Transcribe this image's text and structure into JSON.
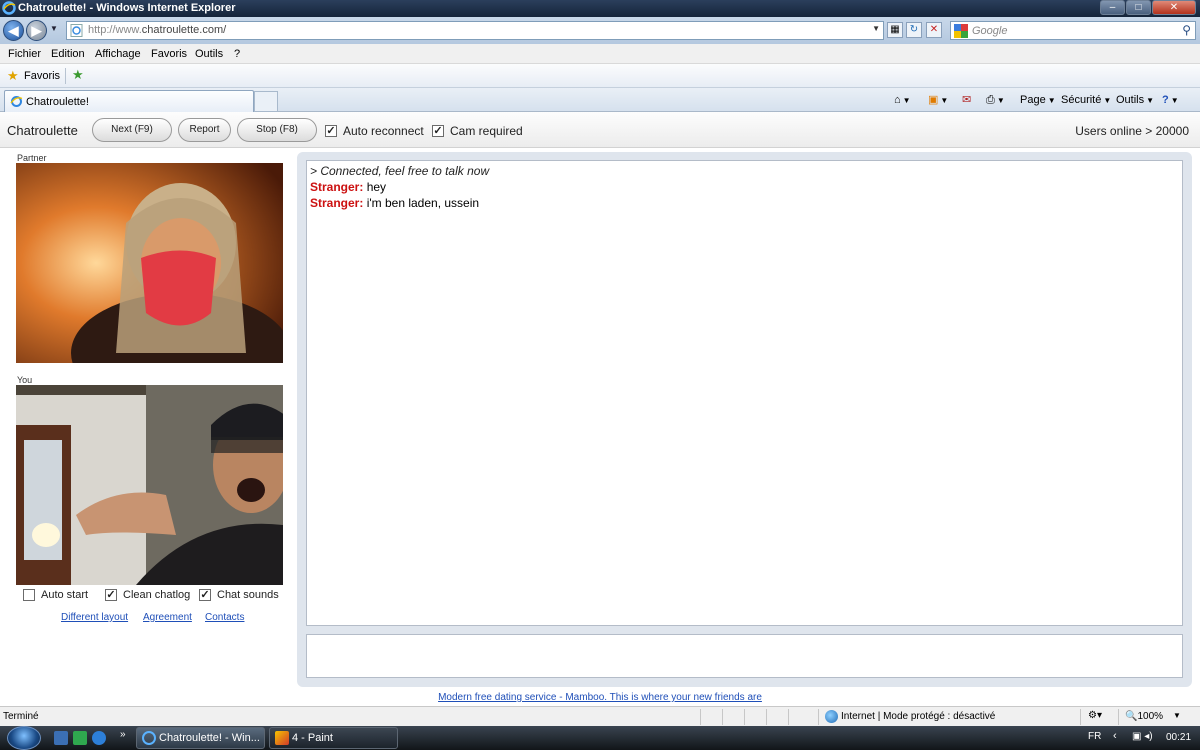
{
  "window": {
    "title": "Chatroulette! - Windows Internet Explorer",
    "controls": {
      "minimize": "–",
      "maximize": "□",
      "close": "✕"
    }
  },
  "address": {
    "url_prefix": "http://www.",
    "url_domain": "chatroulette.com/",
    "search_placeholder": "Google"
  },
  "menu": [
    "Fichier",
    "Edition",
    "Affichage",
    "Favoris",
    "Outils",
    "?"
  ],
  "favorites": {
    "label": "Favoris"
  },
  "tab": {
    "label": "Chatroulette!"
  },
  "commands": {
    "page": "Page",
    "security": "Sécurité",
    "tools": "Outils"
  },
  "app": {
    "name": "Chatroulette",
    "buttons": {
      "next": "Next (F9)",
      "report": "Report",
      "stop": "Stop (F8)"
    },
    "toggles": [
      {
        "label": "Auto reconnect",
        "checked": true
      },
      {
        "label": "Cam required",
        "checked": true
      }
    ],
    "users_online": "Users online > 20000",
    "partner_label": "Partner",
    "you_label": "You",
    "options": [
      {
        "label": "Auto start",
        "checked": false
      },
      {
        "label": "Clean chatlog",
        "checked": true
      },
      {
        "label": "Chat sounds",
        "checked": true
      }
    ],
    "links": [
      "Different layout",
      "Agreement",
      "Contacts"
    ],
    "chat": {
      "system": "> Connected, feel free to talk now",
      "messages": [
        {
          "sender": "Stranger:",
          "text": "hey"
        },
        {
          "sender": "Stranger:",
          "text": "i'm ben laden, ussein"
        }
      ]
    },
    "ad": "Modern free dating service - Mamboo. This is where your new friends are"
  },
  "status": {
    "text": "Terminé",
    "zone": "Internet | Mode protégé : désactivé",
    "zoom": "100%"
  },
  "taskbar": {
    "tasks": [
      "Chatroulette! - Win...",
      "4 - Paint"
    ],
    "lang": "FR",
    "clock": "00:21"
  },
  "colors": {
    "stranger": "#cc1111",
    "link": "#1f4fb8",
    "chat_panel": "#dfe5ed"
  }
}
